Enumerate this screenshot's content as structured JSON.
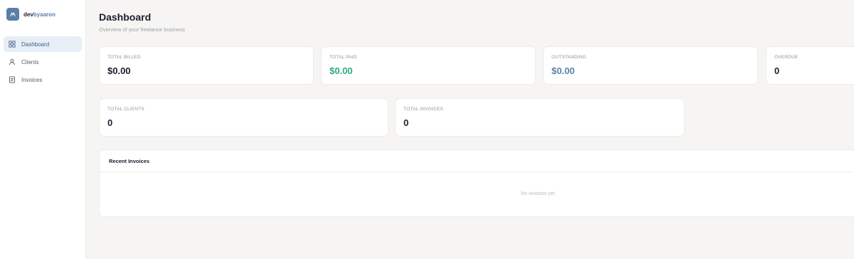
{
  "brand": {
    "part1": "dev",
    "part2": "byaaron"
  },
  "sidebar": {
    "items": [
      {
        "label": "Dashboard",
        "icon": "grid-icon",
        "active": true
      },
      {
        "label": "Clients",
        "icon": "user-icon",
        "active": false
      },
      {
        "label": "Invoices",
        "icon": "document-icon",
        "active": false
      }
    ]
  },
  "header": {
    "title": "Dashboard",
    "subtitle": "Overview of your freelance business"
  },
  "stats": {
    "total_billed": {
      "label": "TOTAL BILLED",
      "value": "$0.00"
    },
    "total_paid": {
      "label": "TOTAL PAID",
      "value": "$0.00"
    },
    "outstanding": {
      "label": "OUTSTANDING",
      "value": "$0.00"
    },
    "overdue": {
      "label": "OVERDUE",
      "value": "0"
    },
    "total_clients": {
      "label": "TOTAL CLIENTS",
      "value": "0"
    },
    "total_invoices": {
      "label": "TOTAL INVOICES",
      "value": "0"
    }
  },
  "recent_invoices": {
    "title": "Recent Invoices",
    "empty_text": "No invoices yet"
  },
  "colors": {
    "accent": "#5b7ea8",
    "paid": "#2daa7f",
    "outstanding": "#5b84a8",
    "background": "#f6f5f3"
  }
}
